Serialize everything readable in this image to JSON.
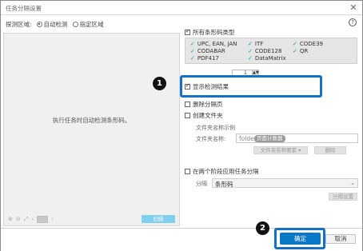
{
  "window": {
    "title": "任务分隔设置",
    "close": "✕"
  },
  "detect_area": {
    "label": "探测区域:",
    "options": [
      {
        "label": "自动检测",
        "selected": true
      },
      {
        "label": "指定区域",
        "selected": false
      }
    ]
  },
  "preview": {
    "message": "执行任务时自动检测条形码。",
    "action_label": "扫描"
  },
  "help": "?",
  "barcode": {
    "all_types_label": "所有条形码类型",
    "types": [
      "UPC, EAN, JAN",
      "ITF",
      "CODE39",
      "CODABAR",
      "CODE128",
      "QR",
      "PDF417",
      "DataMatrix"
    ]
  },
  "spinner": {
    "value": "1"
  },
  "options": {
    "show_result_label": "显示检测结果",
    "delete_separator_label": "删除分隔页",
    "create_folder_label": "创建文件夹"
  },
  "folder": {
    "example_label": "文件夹名称示例",
    "name_label": "文件夹名称:",
    "placeholder": "folder",
    "token": "页面计数器",
    "setting_button": "文件夹名称要素 ▾",
    "delete_button": "删除"
  },
  "apply": {
    "label": "在两个阶段应用任务分隔",
    "separator_label": "分隔",
    "separator_value": "条形码",
    "setting_button": "分隔设置"
  },
  "footer": {
    "ok": "确定",
    "cancel": "取消"
  },
  "callouts": [
    "1",
    "2"
  ],
  "colors": {
    "accent": "#0a78c8",
    "highlight": "#1670c5",
    "check": "#0097c8"
  }
}
